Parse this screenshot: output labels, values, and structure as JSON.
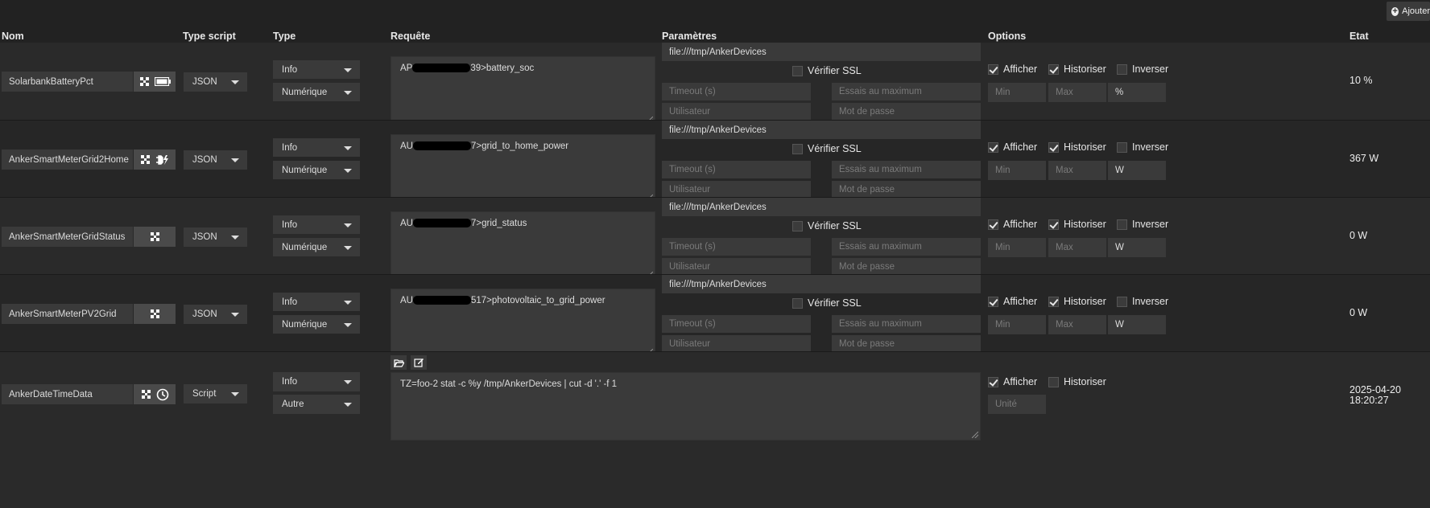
{
  "toolbar": {
    "add_label": "Ajouter"
  },
  "headers": {
    "name": "Nom",
    "script_type": "Type script",
    "type": "Type",
    "request": "Requête",
    "params": "Paramètres",
    "options": "Options",
    "state": "Etat"
  },
  "labels": {
    "verify_ssl": "Vérifier SSL",
    "timeout_ph": "Timeout (s)",
    "max_tries_ph": "Essais au maximum",
    "user_ph": "Utilisateur",
    "password_ph": "Mot de passe",
    "show": "Afficher",
    "historize": "Historiser",
    "invert": "Inverser",
    "min_ph": "Min",
    "max_ph": "Max",
    "unit_ph": "Unité"
  },
  "rows": [
    {
      "name": "SolarbankBatteryPct",
      "icons": [
        "usb-icon",
        "battery-icon"
      ],
      "script_type": "JSON",
      "type": "Info",
      "subtype": "Numérique",
      "request_prefix": "AP",
      "request_suffix": "39>battery_soc",
      "url": "file:///tmp/AnkerDevices",
      "verify_ssl": false,
      "show": true,
      "historize": true,
      "invert": false,
      "unit": "%",
      "state": "10 %"
    },
    {
      "name": "AnkerSmartMeterGrid2Home",
      "icons": [
        "usb-icon",
        "plug-icon"
      ],
      "script_type": "JSON",
      "type": "Info",
      "subtype": "Numérique",
      "request_prefix": "AU",
      "request_suffix": "7>grid_to_home_power",
      "url": "file:///tmp/AnkerDevices",
      "verify_ssl": false,
      "show": true,
      "historize": true,
      "invert": false,
      "unit": "W",
      "state": "367 W"
    },
    {
      "name": "AnkerSmartMeterGridStatus",
      "icons": [
        "usb-icon"
      ],
      "script_type": "JSON",
      "type": "Info",
      "subtype": "Numérique",
      "request_prefix": "AU",
      "request_suffix": "7>grid_status",
      "url": "file:///tmp/AnkerDevices",
      "verify_ssl": false,
      "show": true,
      "historize": true,
      "invert": false,
      "unit": "W",
      "state": "0 W"
    },
    {
      "name": "AnkerSmartMeterPV2Grid",
      "icons": [
        "usb-icon"
      ],
      "script_type": "JSON",
      "type": "Info",
      "subtype": "Numérique",
      "request_prefix": "AU",
      "request_suffix": "517>photovoltaic_to_grid_power",
      "url": "file:///tmp/AnkerDevices",
      "verify_ssl": false,
      "show": true,
      "historize": true,
      "invert": false,
      "unit": "W",
      "state": "0 W"
    }
  ],
  "script_row": {
    "name": "AnkerDateTimeData",
    "icons": [
      "usb-icon",
      "clock-icon"
    ],
    "script_type": "Script",
    "type": "Info",
    "subtype": "Autre",
    "command": "TZ=foo-2 stat -c %y /tmp/AnkerDevices | cut -d '.' -f 1",
    "show": true,
    "historize": false,
    "state_line1": "2025-04-20",
    "state_line2": "18:20:27"
  }
}
